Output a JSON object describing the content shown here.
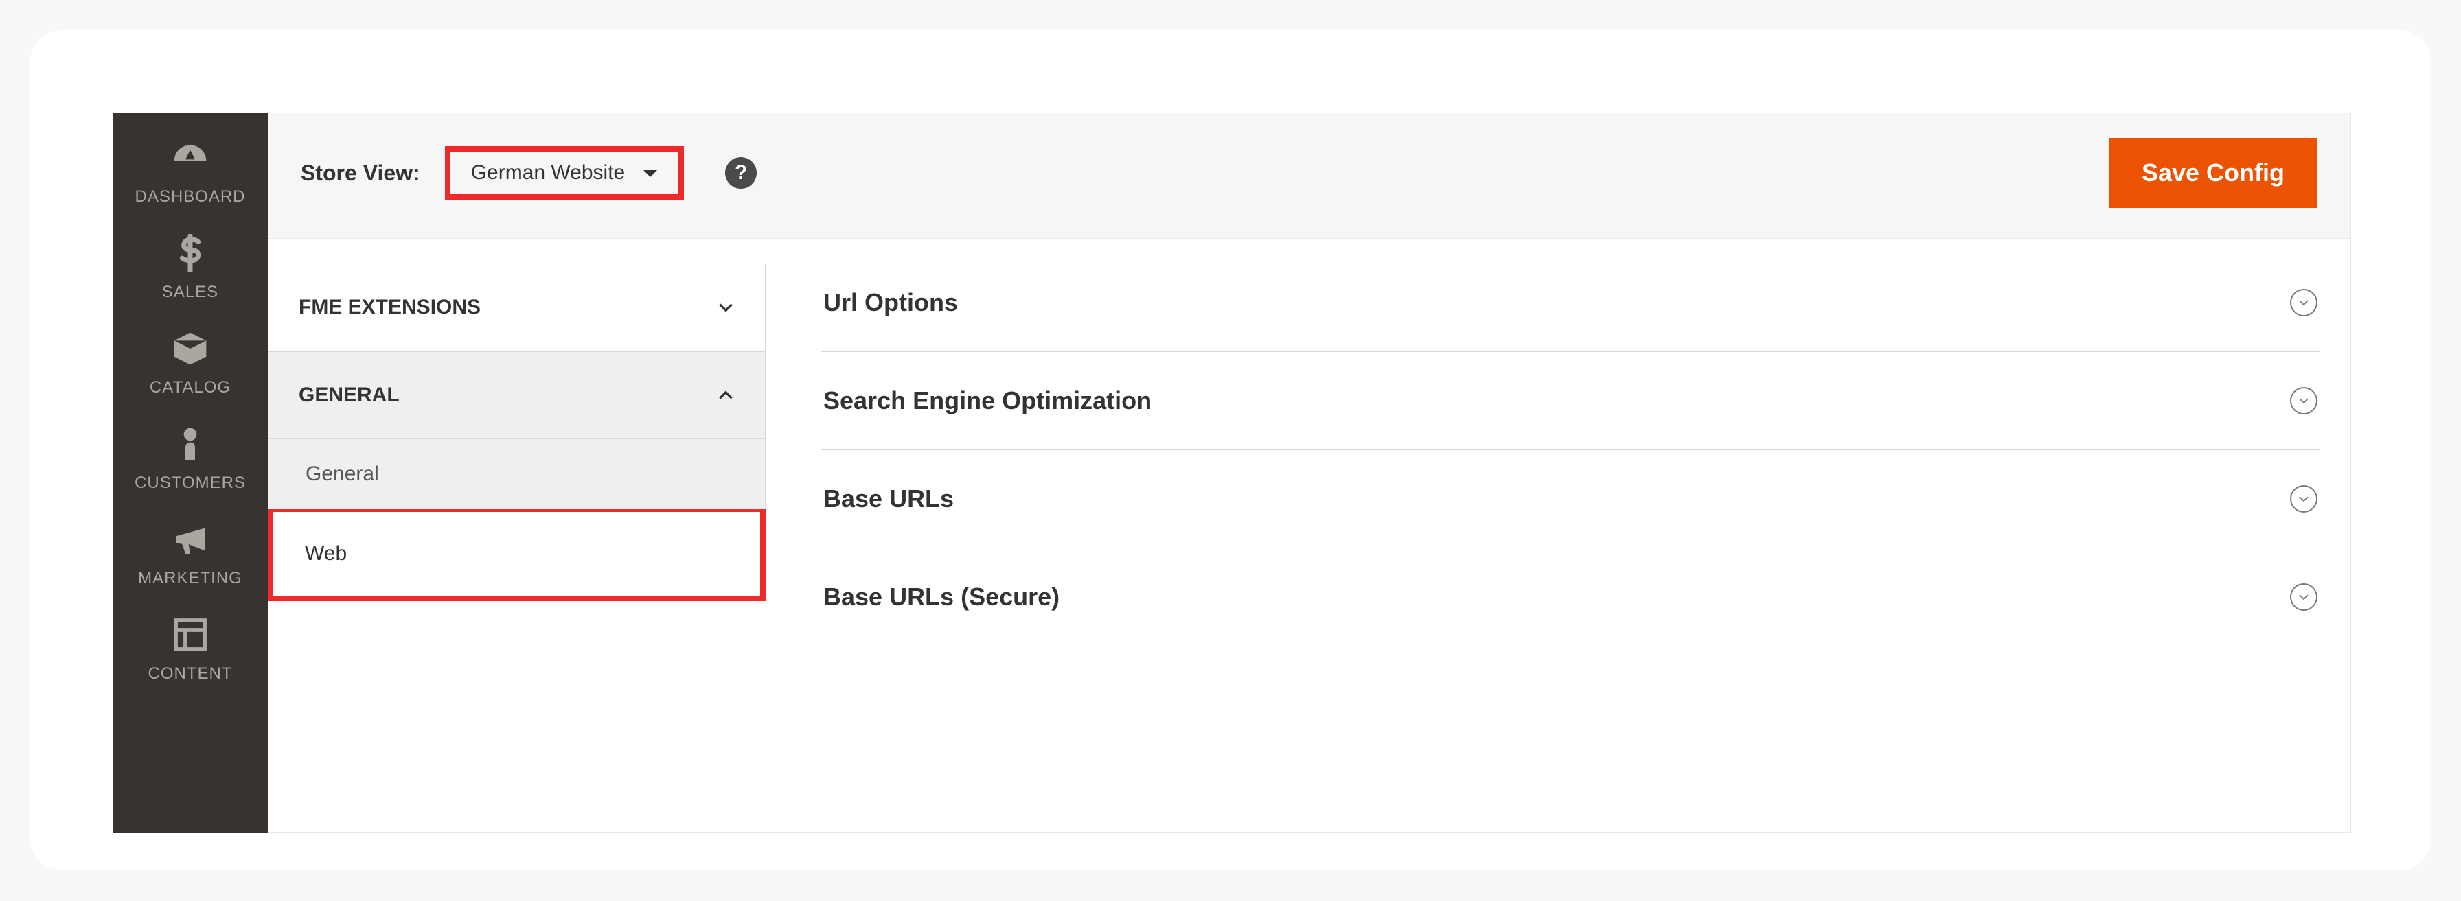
{
  "sidebar": {
    "items": [
      {
        "label": "DASHBOARD"
      },
      {
        "label": "SALES"
      },
      {
        "label": "CATALOG"
      },
      {
        "label": "CUSTOMERS"
      },
      {
        "label": "MARKETING"
      },
      {
        "label": "CONTENT"
      }
    ]
  },
  "toolbar": {
    "store_view_label": "Store View:",
    "selected_store": "German Website",
    "help_glyph": "?",
    "save_label": "Save Config"
  },
  "config_nav": {
    "sections": [
      {
        "label": "FME EXTENSIONS",
        "expanded": false
      },
      {
        "label": "GENERAL",
        "expanded": true,
        "children": [
          {
            "label": "General",
            "active": false
          },
          {
            "label": "Web",
            "active": true
          }
        ]
      }
    ]
  },
  "settings": {
    "groups": [
      {
        "title": "Url Options"
      },
      {
        "title": "Search Engine Optimization"
      },
      {
        "title": "Base URLs"
      },
      {
        "title": "Base URLs (Secure)"
      }
    ]
  },
  "colors": {
    "highlight_border": "#ef2a2a",
    "primary_button": "#eb5202",
    "sidebar_bg": "#373330"
  }
}
